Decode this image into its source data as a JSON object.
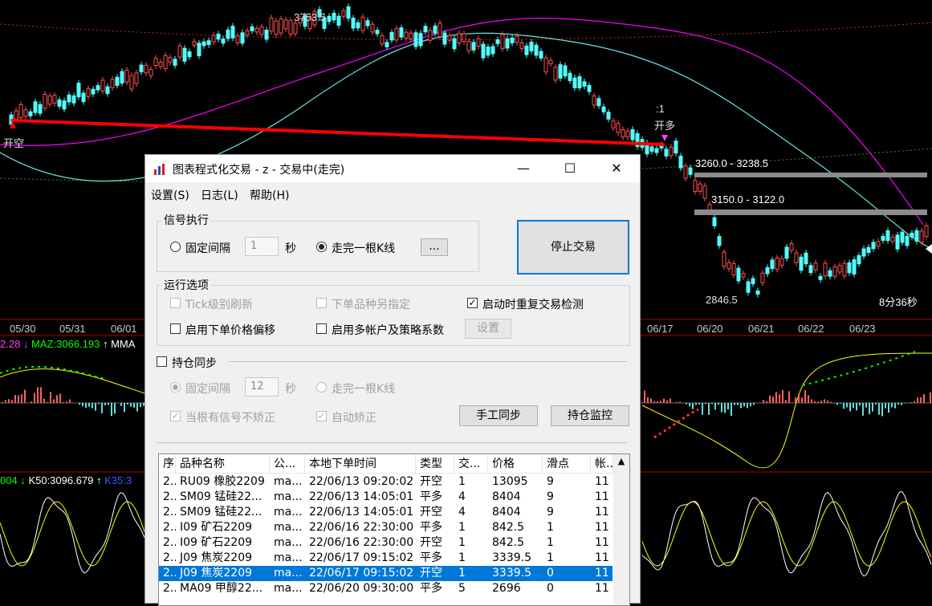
{
  "chart": {
    "price_high_label": "3753.5",
    "price_low_label": "2846.5",
    "signal_left": "开空",
    "signal_mid": "开多",
    "signal_mid_top": ":1",
    "zone_upper": "3260.0 - 3238.5",
    "zone_lower": "3150.0 - 3122.0",
    "timer": "8分36秒",
    "dates": [
      "05/30",
      "05/31",
      "06/01",
      "06/17",
      "06/20",
      "06/21",
      "06/22",
      "06/23"
    ],
    "ind1_left": "2.28",
    "ind1_maz": "MAZ:3066.193",
    "ind1_mma": "MMA",
    "ind2_left": "004",
    "ind2_k50": "K50:3096.679",
    "ind2_k35": "K35:3",
    "colors": {
      "up": "#ff5050",
      "down": "#54fcfc",
      "ma_magenta": "#ff00ff",
      "signal_red": "#ff0000",
      "yellow": "#ffff00",
      "green": "#00ff00"
    }
  },
  "dialog": {
    "title": "图表程式化交易 - z - 交易中(走完)",
    "menus": [
      "设置(S)",
      "日志(L)",
      "帮助(H)"
    ],
    "win_buttons": {
      "minimize": "—",
      "maximize": "☐",
      "close": "✕"
    },
    "signal_exec": {
      "title": "信号执行",
      "fixed_interval": "固定间隔",
      "interval_value": "1",
      "seconds": "秒",
      "bar_close": "走完一根K线",
      "more": "..."
    },
    "stop_button": "停止交易",
    "run_options": {
      "title": "运行选项",
      "tick_refresh": "Tick级别刷新",
      "alt_symbol": "下单品种另指定",
      "startup_check": "启动时重复交易检测",
      "price_offset": "启用下单价格偏移",
      "multi_account": "启用多帐户及策略系数",
      "settings_btn": "设置"
    },
    "position_sync": {
      "title": "持仓同步",
      "fixed_interval": "固定间隔",
      "interval_value": "12",
      "seconds": "秒",
      "bar_close": "走完一根K线",
      "no_fix_on_signal": "当根有信号不矫正",
      "auto_fix": "自动矫正",
      "manual_sync": "手工同步",
      "position_monitor": "持仓监控"
    },
    "table": {
      "headers": [
        "序",
        "品种名称",
        "公...",
        "本地下单时间",
        "类型",
        "交...",
        "价格",
        "滑点",
        "帐..."
      ],
      "rows": [
        [
          "2..",
          "RU09 橡胶2209",
          "ma...",
          "22/06/13 09:20:02",
          "开空",
          "1",
          "13095",
          "9",
          "11"
        ],
        [
          "2..",
          "SM09 锰硅22...",
          "ma...",
          "22/06/13 14:05:01",
          "平多",
          "4",
          "8404",
          "9",
          "11"
        ],
        [
          "2..",
          "SM09 锰硅22...",
          "ma...",
          "22/06/13 14:05:01",
          "开空",
          "4",
          "8404",
          "9",
          "11"
        ],
        [
          "2..",
          "I09 矿石2209",
          "ma...",
          "22/06/16 22:30:00",
          "平多",
          "1",
          "842.5",
          "1",
          "11"
        ],
        [
          "2..",
          "I09 矿石2209",
          "ma...",
          "22/06/16 22:30:00",
          "开空",
          "1",
          "842.5",
          "1",
          "11"
        ],
        [
          "2..",
          "J09 焦炭2209",
          "ma...",
          "22/06/17 09:15:02",
          "平多",
          "1",
          "3339.5",
          "1",
          "11"
        ],
        [
          "2..",
          "J09 焦炭2209",
          "ma...",
          "22/06/17 09:15:02",
          "开空",
          "1",
          "3339.5",
          "0",
          "11"
        ],
        [
          "2..",
          "MA09 甲醇22...",
          "ma...",
          "22/06/20 09:30:00",
          "平多",
          "5",
          "2696",
          "0",
          "11"
        ]
      ],
      "selected_row": 6
    }
  }
}
